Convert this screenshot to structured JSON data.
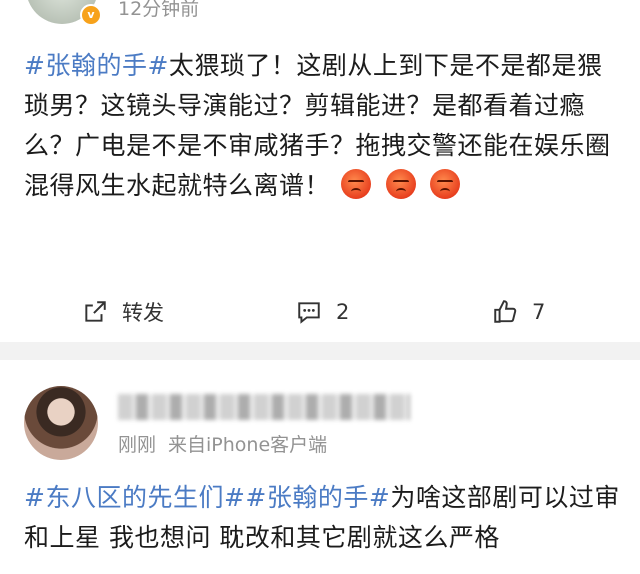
{
  "post1": {
    "time": "12分钟前",
    "topic": "#张翰的手#",
    "text": "太猥琐了！这剧从上到下是不是都是猥琐男？这镜头导演能过？剪辑能进？是都看着过瘾么？广电是不是不审咸猪手？拖拽交警还能在娱乐圈混得风生水起就特么离谱！",
    "emoji_icons": [
      "angry-face",
      "angry-face",
      "angry-face"
    ],
    "actions": {
      "repost_label": "转发",
      "comment_count": "2",
      "like_count": "7"
    }
  },
  "post2": {
    "time": "刚刚",
    "source": "来自iPhone客户端",
    "topic1": "#东八区的先生们#",
    "topic2": "#张翰的手#",
    "text": "为啥这部剧可以过审和上星 我也想问 耽改和其它剧就这么严格"
  },
  "colors": {
    "topic": "#4b7bc4",
    "meta": "#939393",
    "separator": "#f2f2f2",
    "verified_badge": "#f7a21b"
  }
}
